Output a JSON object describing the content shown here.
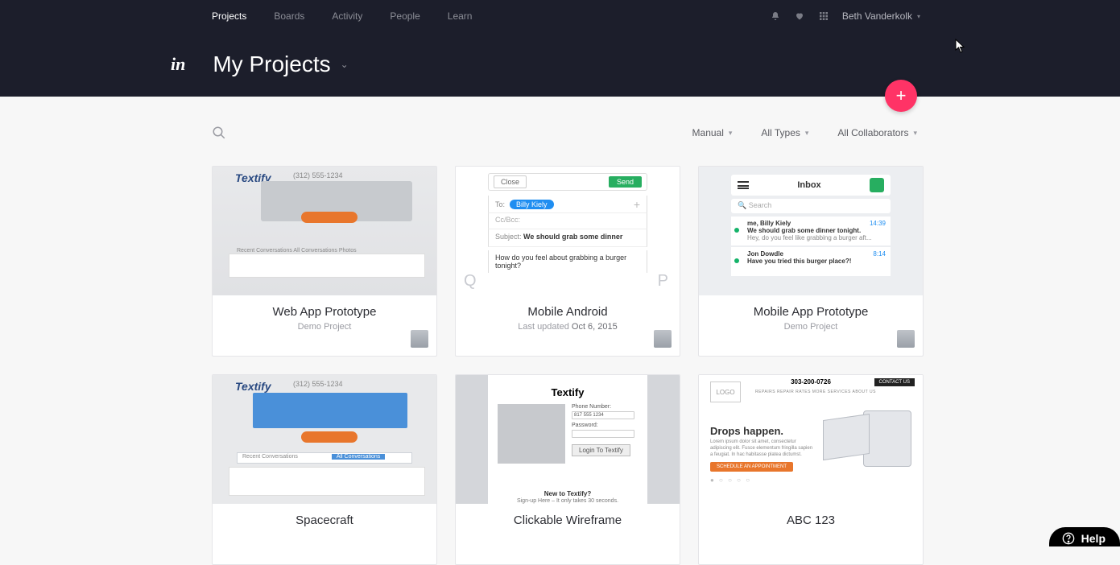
{
  "nav": {
    "items": [
      "Projects",
      "Boards",
      "Activity",
      "People",
      "Learn"
    ],
    "active_index": 0
  },
  "user": {
    "name": "Beth Vanderkolk"
  },
  "logo_text": "in",
  "page": {
    "title": "My Projects"
  },
  "fab": {
    "label": "+"
  },
  "filters": {
    "sort": "Manual",
    "types": "All Types",
    "collaborators": "All Collaborators"
  },
  "projects": [
    {
      "title": "Web App Prototype",
      "subtitle": "Demo Project",
      "thumb": {
        "brand": "Textify",
        "phone": "(312) 555-1234",
        "tabs": "Recent Conversations   All Conversations   Photos"
      }
    },
    {
      "title": "Mobile Android",
      "subtitle_prefix": "Last updated ",
      "subtitle_date": "Oct 6, 2015",
      "thumb": {
        "close": "Close",
        "send": "Send",
        "to_label": "To:",
        "to_pill": "Billy Kiely",
        "cc": "Cc/Bcc:",
        "subject_label": "Subject:",
        "subject_value": "We should grab some dinner",
        "body": "How do you feel about grabbing a burger tonight?",
        "q": "Q",
        "p": "P"
      }
    },
    {
      "title": "Mobile App Prototype",
      "subtitle": "Demo Project",
      "thumb": {
        "inbox": "Inbox",
        "search": "Search",
        "row1_from": "me, Billy Kiely",
        "row1_time": "14:39",
        "row1_subj": "We should grab some dinner tonight.",
        "row1_prev": "Hey, do you feel like grabbing a burger aft...",
        "row2_from": "Jon Dowdle",
        "row2_time": "8:14",
        "row2_subj": "Have you tried this burger place?!"
      }
    },
    {
      "title": "Spacecraft",
      "thumb": {
        "brand": "Textify",
        "phone": "(312) 555-1234",
        "tabs_a": "Recent Conversations",
        "tabs_b": "All Conversations"
      }
    },
    {
      "title": "Clickable Wireframe",
      "thumb": {
        "brand": "Textify",
        "ph_label": "Phone Number:",
        "ph_val": "817 555 1234",
        "pw_label": "Password:",
        "login": "Login To Textify",
        "foot1": "New to Textify?",
        "foot2": "Sign-up Here – It only takes 30 seconds."
      }
    },
    {
      "title": "ABC 123",
      "thumb": {
        "logo": "LOGO",
        "phone": "303-200-0726",
        "nav": "REPAIRS    REPAIR RATES    MORE SERVICES    ABOUT US",
        "contact": "CONTACT US",
        "headline": "Drops happen.",
        "lorem": "Lorem ipsum dolor sit amet, consectetur adipiscing elit. Fusce elementum fringilla sapien a feugiat. In hac habitasse platea dictumst.",
        "cta": "SCHEDULE AN APPOINTMENT",
        "dots": "● ○ ○ ○ ○"
      }
    }
  ],
  "help": {
    "label": "Help"
  }
}
